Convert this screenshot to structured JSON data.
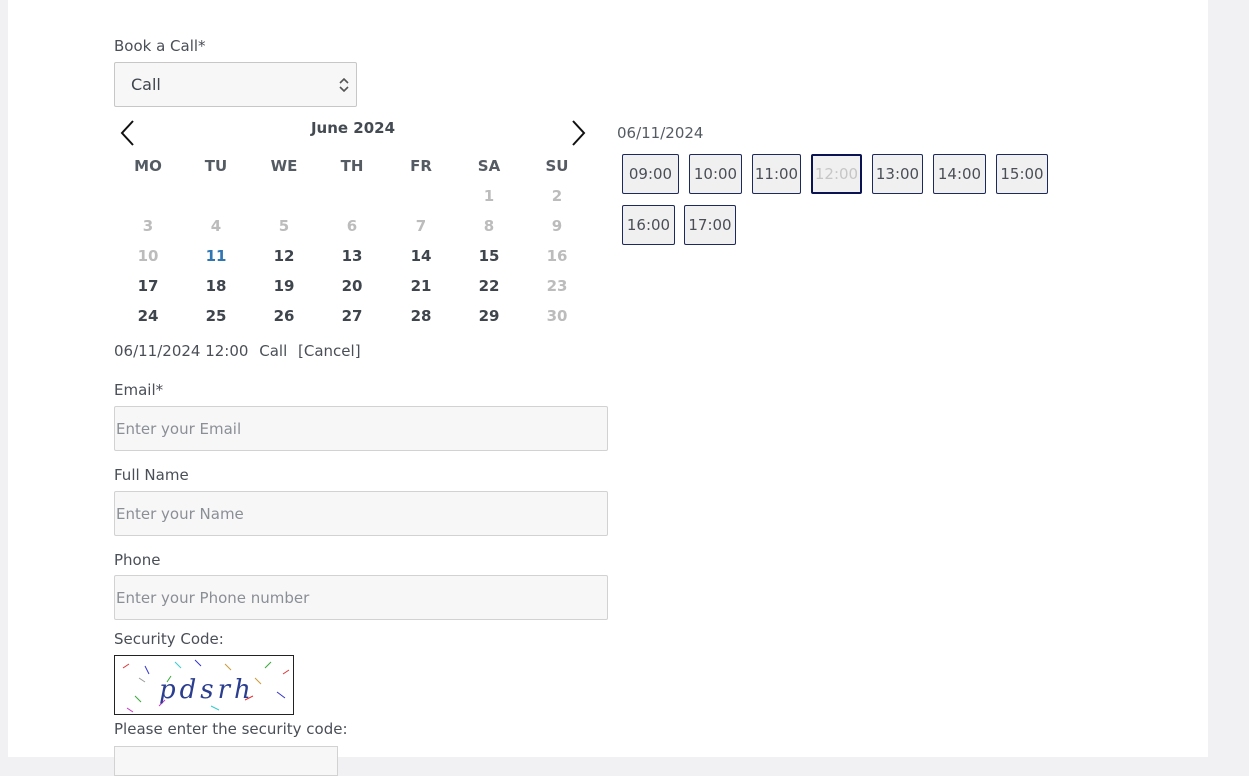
{
  "form": {
    "book_label": "Book a Call*",
    "book_select_value": "Call"
  },
  "calendar": {
    "month_title": "June 2024",
    "weekdays": [
      "MO",
      "TU",
      "WE",
      "TH",
      "FR",
      "SA",
      "SU"
    ],
    "weeks": [
      [
        {
          "d": "",
          "s": "empty"
        },
        {
          "d": "",
          "s": "empty"
        },
        {
          "d": "",
          "s": "empty"
        },
        {
          "d": "",
          "s": "empty"
        },
        {
          "d": "",
          "s": "empty"
        },
        {
          "d": "1",
          "s": "disabled"
        },
        {
          "d": "2",
          "s": "disabled"
        }
      ],
      [
        {
          "d": "3",
          "s": "disabled"
        },
        {
          "d": "4",
          "s": "disabled"
        },
        {
          "d": "5",
          "s": "disabled"
        },
        {
          "d": "6",
          "s": "disabled"
        },
        {
          "d": "7",
          "s": "disabled"
        },
        {
          "d": "8",
          "s": "disabled"
        },
        {
          "d": "9",
          "s": "disabled"
        }
      ],
      [
        {
          "d": "10",
          "s": "disabled"
        },
        {
          "d": "11",
          "s": "today"
        },
        {
          "d": "12",
          "s": "available"
        },
        {
          "d": "13",
          "s": "available"
        },
        {
          "d": "14",
          "s": "available"
        },
        {
          "d": "15",
          "s": "available"
        },
        {
          "d": "16",
          "s": "disabled"
        }
      ],
      [
        {
          "d": "17",
          "s": "available"
        },
        {
          "d": "18",
          "s": "available"
        },
        {
          "d": "19",
          "s": "available"
        },
        {
          "d": "20",
          "s": "available"
        },
        {
          "d": "21",
          "s": "available"
        },
        {
          "d": "22",
          "s": "available"
        },
        {
          "d": "23",
          "s": "disabled"
        }
      ],
      [
        {
          "d": "24",
          "s": "available"
        },
        {
          "d": "25",
          "s": "available"
        },
        {
          "d": "26",
          "s": "available"
        },
        {
          "d": "27",
          "s": "available"
        },
        {
          "d": "28",
          "s": "available"
        },
        {
          "d": "29",
          "s": "available"
        },
        {
          "d": "30",
          "s": "disabled"
        }
      ]
    ]
  },
  "slots": {
    "date_header": "06/11/2024",
    "times": [
      {
        "label": "09:00",
        "selected": false
      },
      {
        "label": "10:00",
        "selected": false
      },
      {
        "label": "11:00",
        "selected": false
      },
      {
        "label": "12:00",
        "selected": true
      },
      {
        "label": "13:00",
        "selected": false
      },
      {
        "label": "14:00",
        "selected": false
      },
      {
        "label": "15:00",
        "selected": false
      },
      {
        "label": "16:00",
        "selected": false
      },
      {
        "label": "17:00",
        "selected": false
      }
    ]
  },
  "summary": {
    "datetime": "06/11/2024 12:00",
    "type": "Call",
    "cancel": "[Cancel]"
  },
  "fields": {
    "email_label": "Email*",
    "email_placeholder": "Enter your Email",
    "name_label": "Full Name",
    "name_placeholder": "Enter your Name",
    "phone_label": "Phone",
    "phone_placeholder": "Enter your Phone number"
  },
  "security": {
    "label": "Security Code:",
    "captcha_text": "pdsrh",
    "enter_label": "Please enter the security code:"
  },
  "colors": {
    "accent": "#0b1453",
    "today": "#3076b3",
    "disabled": "#bcbcbc"
  }
}
